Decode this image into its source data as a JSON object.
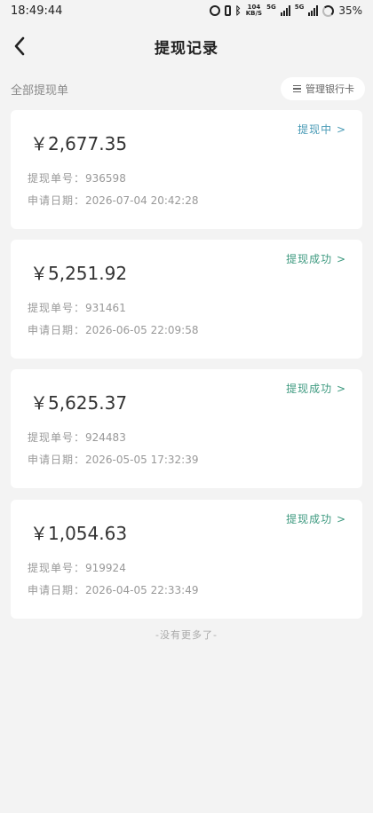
{
  "status_bar": {
    "time": "18:49:44",
    "net_speed_value": "104",
    "net_speed_unit": "KB/S",
    "sim1_tag": "5G",
    "sim2_tag": "5G",
    "battery": "35%"
  },
  "nav": {
    "title": "提现记录"
  },
  "filter": {
    "label": "全部提现单",
    "manage_label": "管理银行卡"
  },
  "labels": {
    "order_no": "提现单号：",
    "apply_date": "申请日期："
  },
  "withdrawals": [
    {
      "amount": "￥2,677.35",
      "status": "提现中 >",
      "status_color": "#4a9bb6",
      "order_no": "936598",
      "date": "2026-07-04 20:42:28"
    },
    {
      "amount": "￥5,251.92",
      "status": "提现成功 >",
      "status_color": "#3e9a80",
      "order_no": "931461",
      "date": "2026-06-05 22:09:58"
    },
    {
      "amount": "￥5,625.37",
      "status": "提现成功 >",
      "status_color": "#3e9a80",
      "order_no": "924483",
      "date": "2026-05-05 17:32:39"
    },
    {
      "amount": "￥1,054.63",
      "status": "提现成功 >",
      "status_color": "#3e9a80",
      "order_no": "919924",
      "date": "2026-04-05 22:33:49"
    }
  ],
  "footer": {
    "no_more": "-没有更多了-"
  },
  "icons": [
    "alarm-icon",
    "vibrate-icon",
    "bluetooth-icon",
    "signal-icon",
    "battery-icon",
    "back-arrow-icon",
    "menu-icon"
  ]
}
